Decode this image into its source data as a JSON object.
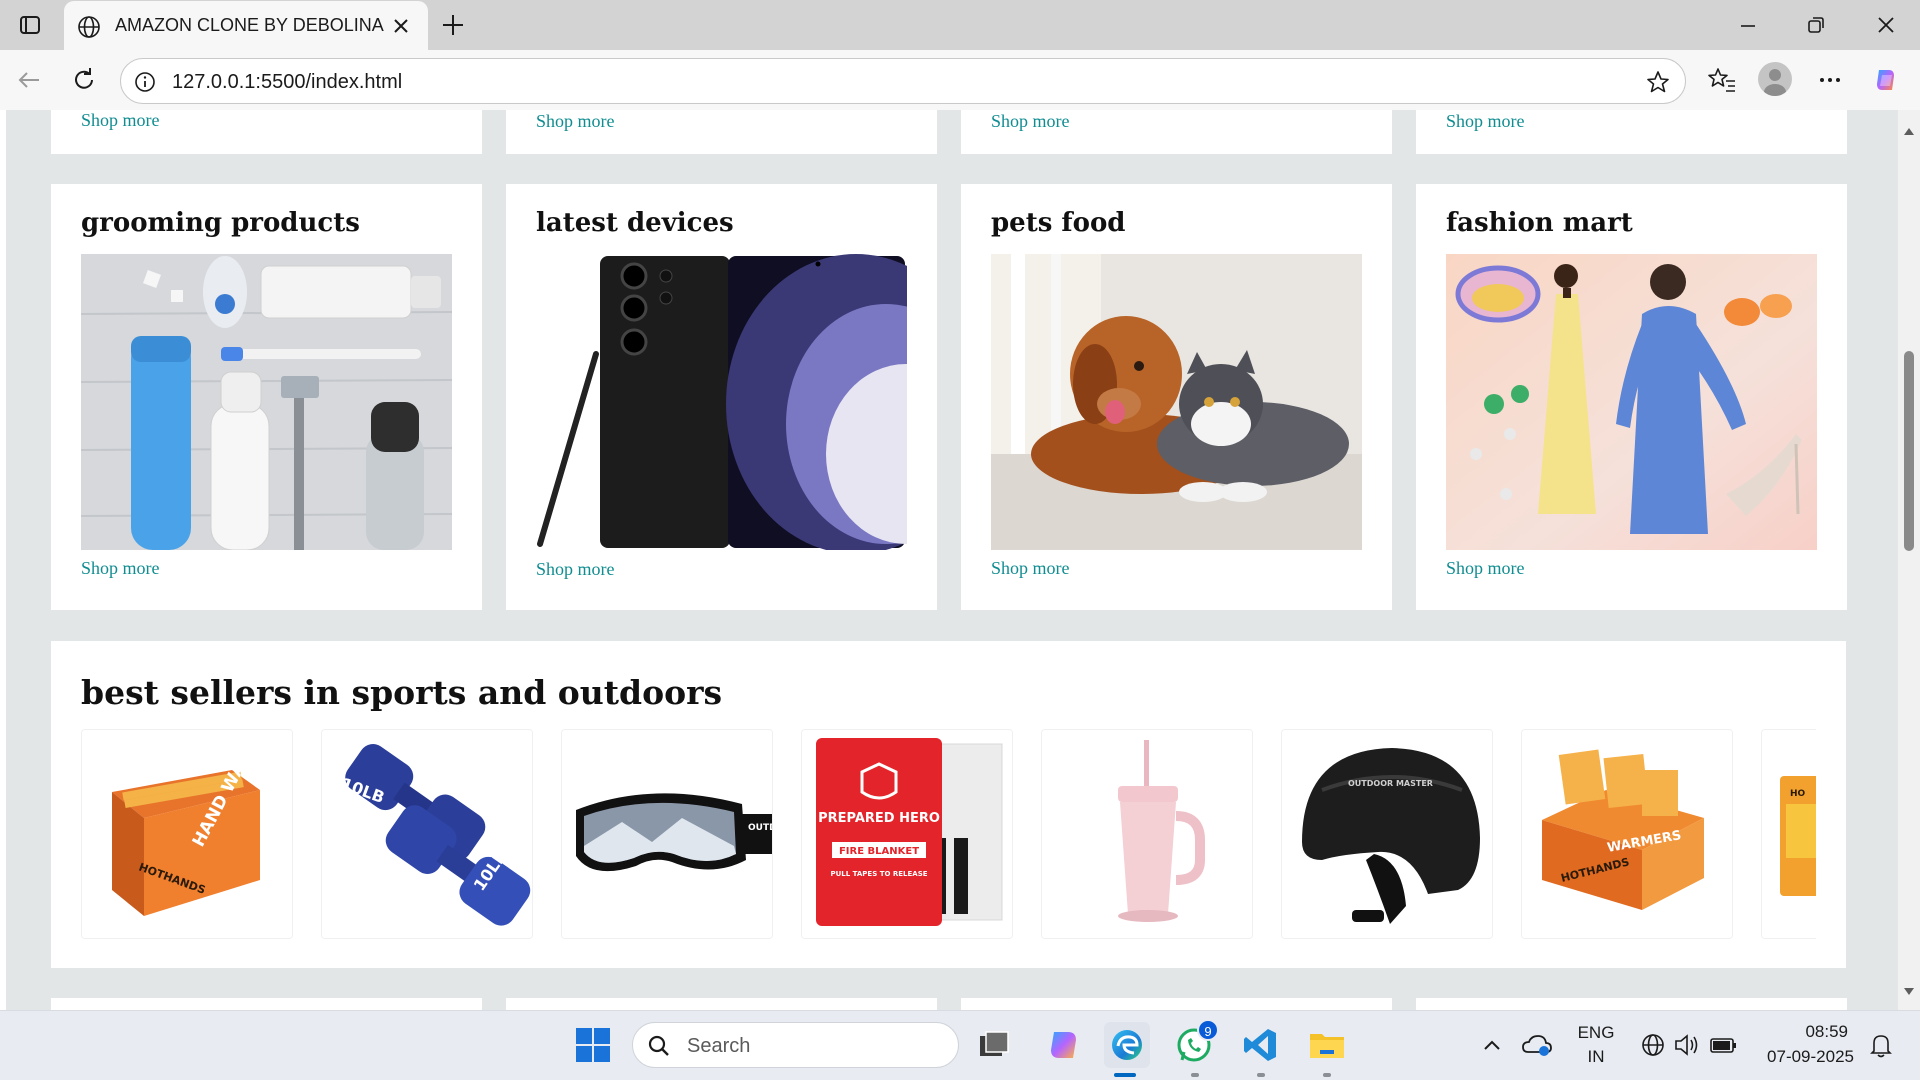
{
  "browser": {
    "tab_title": "AMAZON CLONE BY DEBOLINA",
    "address": "127.0.0.1:5500/index.html"
  },
  "top_row": {
    "shop_more_labels": [
      "Shop more",
      "Shop more",
      "Shop more",
      "Shop more"
    ]
  },
  "cards": [
    {
      "title": "grooming products",
      "link": "Shop more"
    },
    {
      "title": "latest devices",
      "link": "Shop more"
    },
    {
      "title": "pets food",
      "link": "Shop more"
    },
    {
      "title": "fashion mart",
      "link": "Shop more"
    }
  ],
  "best_sellers": {
    "title": "best sellers in sports and outdoors",
    "products": [
      {
        "name": "hand-warmers-box-image",
        "brand": "HOTHANDS",
        "label": "HAND WARMERS"
      },
      {
        "name": "dumbbells-image",
        "weight_label": "10LB"
      },
      {
        "name": "ski-goggles-image",
        "brand": "OUTDOOR MASTER"
      },
      {
        "name": "fire-blanket-image",
        "brand": "PREPARED HERO",
        "label": "FIRE BLANKET",
        "sub": "PULL TAPES TO RELEASE"
      },
      {
        "name": "tumbler-image"
      },
      {
        "name": "helmet-image",
        "brand": "OUTDOOR MASTER"
      },
      {
        "name": "hand-warmers-display-image",
        "brand": "HOTHANDS",
        "label": "WARMERS"
      },
      {
        "name": "hand-warmers-pack-image",
        "brand": "HO"
      }
    ]
  },
  "taskbar": {
    "search_placeholder": "Search",
    "whatsapp_badge": "9",
    "lang_top": "ENG",
    "lang_bottom": "IN",
    "time": "08:59",
    "date": "07-09-2025"
  },
  "colors": {
    "link": "#108d91",
    "page_bg": "#e3e6e6",
    "card_bg": "#ffffff",
    "taskbar_bg": "#e8ecf2",
    "accent": "#0067c0"
  }
}
